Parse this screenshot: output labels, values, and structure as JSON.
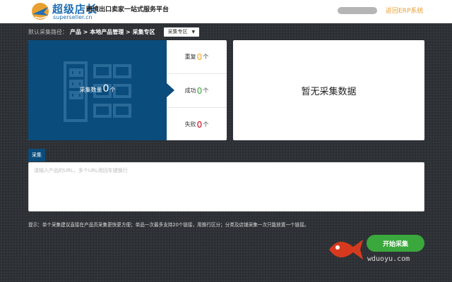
{
  "header": {
    "brand_cn": "超级店长",
    "brand_en": "superseller.cn",
    "slogan": "跨境出口卖家一站式服务平台",
    "erp_link": "返回ERP系统"
  },
  "path": {
    "label": "默认采集路径：",
    "value": "产品 > 本地产品管理 > 采集专区",
    "select_value": "采集专区"
  },
  "stats": {
    "total_label": "采集数量",
    "total_count": "0",
    "total_unit": "个",
    "items": [
      {
        "label": "重复",
        "count": "0",
        "unit": "个",
        "color": "#f5a623"
      },
      {
        "label": "成功",
        "count": "0",
        "unit": "个",
        "color": "#3aa83c"
      },
      {
        "label": "失败",
        "count": "0",
        "unit": "个",
        "color": "#d0021b"
      }
    ]
  },
  "result": {
    "empty_text": "暂无采集数据"
  },
  "collect": {
    "tab_label": "采集",
    "placeholder": "请输入产品的URL，多个URL用回车键换行"
  },
  "tip": "提示：单个采集建议直接在产品页采集更快更方便；单品一次最多支持20个链接，用换行区分；分类及店铺采集一次只能放置一个链接。",
  "start_button": "开始采集",
  "watermark_text": "wduoyu.com",
  "colors": {
    "primary": "#0a4c7c",
    "accent": "#e8a030",
    "success": "#3aa83c"
  }
}
